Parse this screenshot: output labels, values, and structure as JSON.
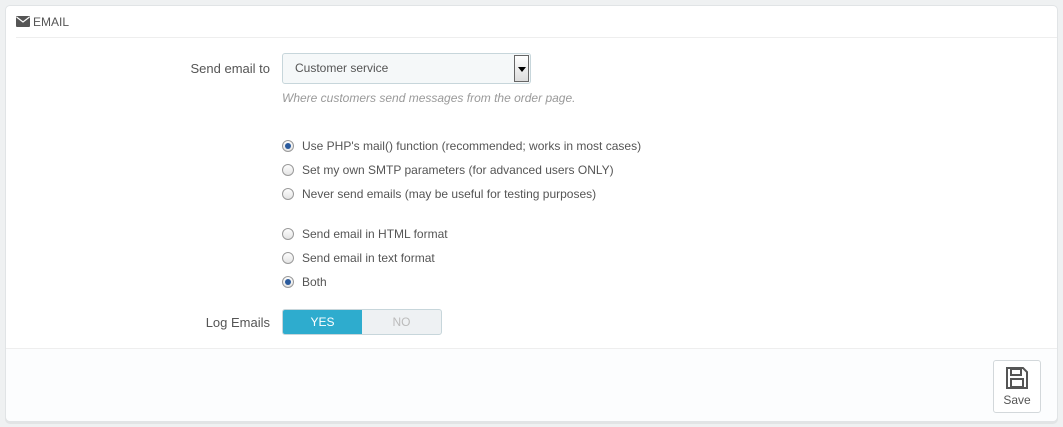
{
  "panel": {
    "title": "EMAIL"
  },
  "send_email_to": {
    "label": "Send email to",
    "selected": "Customer service",
    "help": "Where customers send messages from the order page."
  },
  "mail_method": {
    "options": [
      {
        "label": "Use PHP's mail() function (recommended; works in most cases)",
        "checked": true
      },
      {
        "label": "Set my own SMTP parameters (for advanced users ONLY)",
        "checked": false
      },
      {
        "label": "Never send emails (may be useful for testing purposes)",
        "checked": false
      }
    ]
  },
  "mail_format": {
    "options": [
      {
        "label": "Send email in HTML format",
        "checked": false
      },
      {
        "label": "Send email in text format",
        "checked": false
      },
      {
        "label": "Both",
        "checked": true
      }
    ]
  },
  "log_emails": {
    "label": "Log Emails",
    "yes": "YES",
    "no": "NO",
    "value": "YES"
  },
  "footer": {
    "save_label": "Save"
  },
  "colors": {
    "accent": "#2eacce",
    "radio_dot": "#2a5a9c"
  }
}
